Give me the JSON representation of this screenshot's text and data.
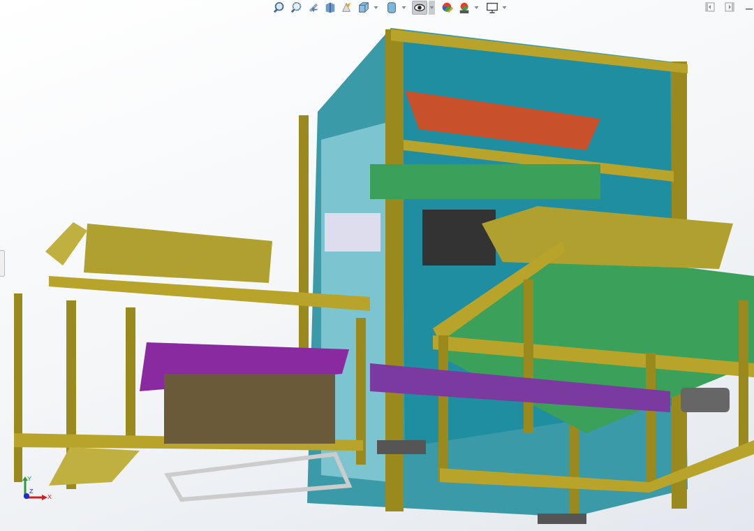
{
  "view_toolbar": [
    {
      "kind": "zoom-fit",
      "dropdown": false,
      "selected": false
    },
    {
      "kind": "zoom-area",
      "dropdown": false,
      "selected": false
    },
    {
      "kind": "previous-view",
      "dropdown": false,
      "selected": false
    },
    {
      "kind": "section-view",
      "dropdown": false,
      "selected": false
    },
    {
      "kind": "dynamic-annotation",
      "dropdown": false,
      "selected": false
    },
    {
      "kind": "view-orientation",
      "dropdown": true,
      "selected": false
    },
    {
      "kind": "display-style",
      "dropdown": true,
      "selected": false
    },
    {
      "kind": "hide-show",
      "dropdown": true,
      "selected": true
    },
    {
      "kind": "edit-appearance",
      "dropdown": false,
      "selected": false
    },
    {
      "kind": "apply-scene",
      "dropdown": true,
      "selected": false
    },
    {
      "kind": "view-settings",
      "dropdown": true,
      "selected": false
    }
  ],
  "window_controls": [
    {
      "kind": "tile-left"
    },
    {
      "kind": "tile-right"
    },
    {
      "kind": "minimize"
    }
  ],
  "triad": {
    "labels": [
      "Y",
      "Z",
      "X"
    ]
  }
}
